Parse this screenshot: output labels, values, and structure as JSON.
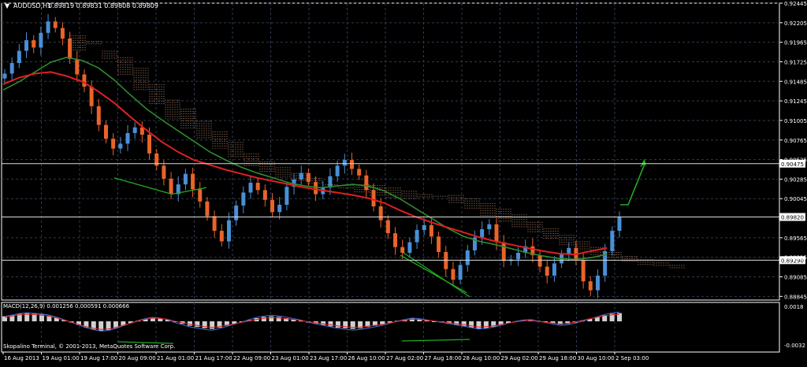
{
  "header": {
    "symbol": "AUDUSD,H1",
    "ohlc": "0.89819 0.89831 0.89808 0.89809"
  },
  "macd_label": "MACD(12,26,9) 0.001256 0.000591 0.000666",
  "copyright": "Skopalino Terminal, © 2001-2013, MetaQuotes Software Corp.",
  "colors": {
    "background": "#000000",
    "grid": "#2f3a4f",
    "bull_candle": "#4a8fd6",
    "bear_candle": "#e8642a",
    "ma_fast": "#2e8b2e",
    "ma_slow": "#e02020",
    "cloud": "#d8a080",
    "macd_hist": "#d0d0d0",
    "macd_signal": "#e02020",
    "macd_line": "#3a6fd8",
    "arrow": "#22aa22",
    "hline": "#dcdcdc",
    "axis_text": "#ffffff"
  },
  "chart_data": {
    "type": "candlestick",
    "y_ticks": [
      "0.92445",
      "0.92205",
      "0.91965",
      "0.91725",
      "0.91485",
      "0.91245",
      "0.91005",
      "0.90765",
      "0.90525",
      "0.90285",
      "0.90045",
      "0.89565",
      "0.89325",
      "0.89085",
      "0.88845"
    ],
    "ylim": [
      0.888,
      0.92445
    ],
    "price_tags": [
      "0.90475",
      "0.89820",
      "0.89290"
    ],
    "x_ticks": [
      "16 Aug 2013",
      "19 Aug 01:00",
      "19 Aug 17:00",
      "20 Aug 09:00",
      "21 Aug 01:00",
      "21 Aug 17:00",
      "22 Aug 09:00",
      "23 Aug 01:00",
      "23 Aug 17:00",
      "26 Aug 10:00",
      "27 Aug 02:00",
      "27 Aug 18:00",
      "28 Aug 10:00",
      "29 Aug 02:00",
      "29 Aug 18:00",
      "30 Aug 10:00",
      "2 Sep 03:00"
    ],
    "closes": [
      0.9158,
      0.9171,
      0.9186,
      0.9199,
      0.919,
      0.9208,
      0.9222,
      0.9214,
      0.9201,
      0.9176,
      0.9157,
      0.9142,
      0.9118,
      0.9095,
      0.9078,
      0.9066,
      0.9072,
      0.9085,
      0.9092,
      0.9083,
      0.906,
      0.9045,
      0.9029,
      0.901,
      0.9022,
      0.9035,
      0.9016,
      0.9001,
      0.8983,
      0.8965,
      0.8952,
      0.8978,
      0.8996,
      0.9012,
      0.9024,
      0.9015,
      0.9003,
      0.8988,
      0.8997,
      0.9019,
      0.9028,
      0.9036,
      0.9025,
      0.901,
      0.9018,
      0.9032,
      0.9045,
      0.9052,
      0.9041,
      0.9033,
      0.9015,
      0.8995,
      0.8978,
      0.8962,
      0.8945,
      0.8938,
      0.8951,
      0.8966,
      0.8972,
      0.8958,
      0.8939,
      0.8918,
      0.8905,
      0.8923,
      0.8941,
      0.8957,
      0.8967,
      0.8973,
      0.8951,
      0.8928,
      0.893,
      0.8938,
      0.8946,
      0.8935,
      0.8921,
      0.891,
      0.8925,
      0.8936,
      0.8944,
      0.8929,
      0.8903,
      0.8892,
      0.891,
      0.894,
      0.8965,
      0.8982
    ],
    "ichimoku_span_a": [
      0.9185,
      0.9192,
      0.9186,
      0.9178,
      0.9165,
      0.9145,
      0.9126,
      0.9115,
      0.91,
      0.9087,
      0.9074,
      0.906,
      0.905,
      0.9043,
      0.9036,
      0.903,
      0.9022,
      0.9016,
      0.9012,
      0.9008,
      0.9004,
      0.9004,
      0.9006,
      0.9008,
      0.9009,
      0.9005,
      0.8999,
      0.8992,
      0.8985,
      0.8976,
      0.8968,
      0.896,
      0.8952,
      0.8945,
      0.8939,
      0.8934,
      0.893,
      0.8926,
      0.8923
    ],
    "ichimoku_span_b": [
      0.9205,
      0.9198,
      0.9176,
      0.9155,
      0.9136,
      0.912,
      0.9102,
      0.909,
      0.9078,
      0.9066,
      0.9055,
      0.9044,
      0.9036,
      0.903,
      0.9026,
      0.9022,
      0.902,
      0.9021,
      0.9022,
      0.9021,
      0.9018,
      0.9014,
      0.901,
      0.9005,
      0.8998,
      0.8991,
      0.8983,
      0.8975,
      0.8968,
      0.8962,
      0.8955,
      0.8947,
      0.894,
      0.8935,
      0.8931,
      0.8926,
      0.8923,
      0.8921,
      0.8919
    ],
    "ma_fast": [
      0.9138,
      0.9148,
      0.916,
      0.9172,
      0.9178,
      0.9174,
      0.9165,
      0.915,
      0.9132,
      0.9115,
      0.9101,
      0.9088,
      0.9075,
      0.9062,
      0.9052,
      0.9043,
      0.9036,
      0.903,
      0.9024,
      0.902,
      0.9018,
      0.902,
      0.9022,
      0.902,
      0.9014,
      0.9004,
      0.8992,
      0.898,
      0.8968,
      0.8958,
      0.8952,
      0.8948,
      0.8943,
      0.8938,
      0.8934,
      0.8931,
      0.893,
      0.8932,
      0.8936
    ],
    "ma_slow": [
      0.9145,
      0.9153,
      0.9158,
      0.916,
      0.9155,
      0.9148,
      0.9136,
      0.9122,
      0.9105,
      0.9089,
      0.9074,
      0.9062,
      0.9052,
      0.9046,
      0.904,
      0.9035,
      0.903,
      0.9026,
      0.9022,
      0.9018,
      0.9015,
      0.9012,
      0.9009,
      0.9005,
      0.8999,
      0.899,
      0.8982,
      0.8975,
      0.8969,
      0.8963,
      0.8957,
      0.8952,
      0.8948,
      0.8944,
      0.894,
      0.8937,
      0.8936,
      0.894,
      0.8944
    ],
    "macd_axis": [
      "0.0018",
      "-0.0032"
    ],
    "macd_hist": [
      0.0008,
      0.001,
      0.0012,
      0.0013,
      0.0012,
      0.0011,
      0.0009,
      0.0006,
      0.0002,
      -0.0002,
      -0.0006,
      -0.001,
      -0.0013,
      -0.0015,
      -0.0014,
      -0.0011,
      -0.0007,
      -0.0003,
      0.0001,
      0.0004,
      0.0006,
      0.0005,
      0.0003,
      -0.0001,
      -0.0004,
      -0.0007,
      -0.0009,
      -0.0011,
      -0.0012,
      -0.001,
      -0.0007,
      -0.0004,
      -0.0001,
      0.0002,
      0.0005,
      0.0007,
      0.0008,
      0.0007,
      0.0005,
      0.0003,
      0.0001,
      -0.0002,
      -0.0004,
      -0.0006,
      -0.0008,
      -0.001,
      -0.0011,
      -0.0012,
      -0.0011,
      -0.0009,
      -0.0007,
      -0.0005,
      -0.0002,
      0.0001,
      0.0003,
      0.0005,
      0.0004,
      0.0002,
      0.0,
      -0.0002,
      -0.0004,
      -0.0006,
      -0.0008,
      -0.001,
      -0.0012,
      -0.0011,
      -0.0009,
      -0.0006,
      -0.0003,
      0.0,
      0.0002,
      0.0003,
      0.0001,
      -0.0001,
      -0.0003,
      -0.0005,
      -0.0004,
      -0.0002,
      0.0001,
      0.0004,
      0.0007,
      0.001,
      0.0012,
      0.0013
    ]
  }
}
